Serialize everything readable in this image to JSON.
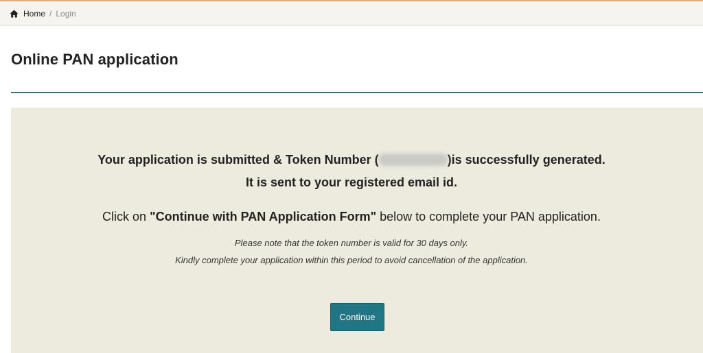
{
  "breadcrumb": {
    "icon": "home-icon",
    "home_label": "Home",
    "separator": "/",
    "current_label": "Login"
  },
  "page": {
    "title": "Online PAN application"
  },
  "message": {
    "line1_prefix": "Your application is submitted & Token Number (",
    "line1_suffix": ")is successfully generated.",
    "line2": "It is sent to your registered email id.",
    "instruction_prefix": "Click on ",
    "instruction_bold": "\"Continue with PAN Application Form\"",
    "instruction_suffix": " below to complete your PAN application.",
    "note1": "Please note that the token number is valid for 30 days only.",
    "note2": "Kindly complete your application within this period to avoid cancellation of the application."
  },
  "actions": {
    "continue_label": "Continue"
  },
  "colors": {
    "accent_top": "#f0a868",
    "title_rule": "#3f6f78",
    "panel_bg": "#ecebde",
    "button_bg": "#1f7684"
  }
}
